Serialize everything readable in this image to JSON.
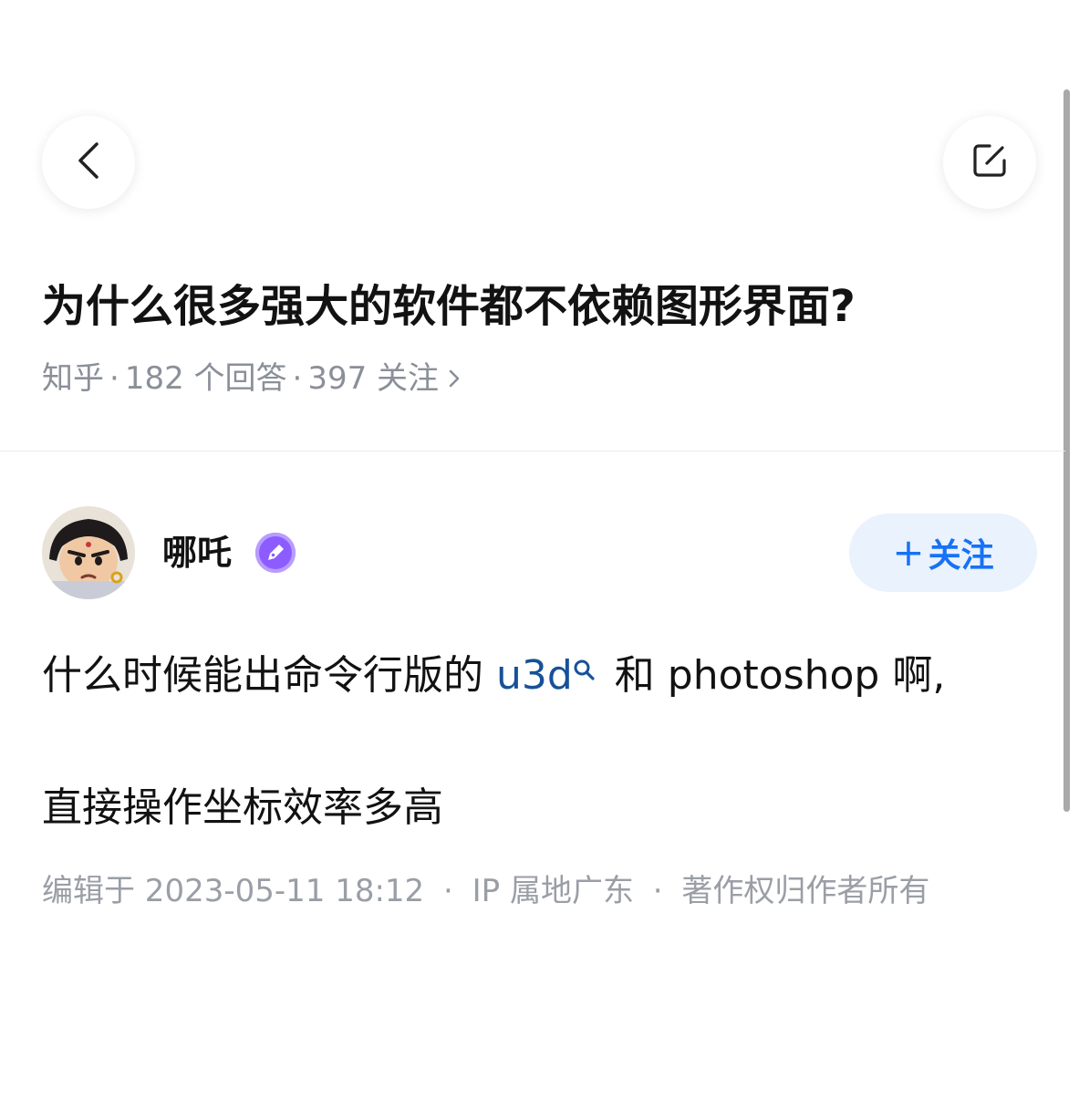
{
  "question": {
    "title": "为什么很多强大的软件都不依赖图形界面?",
    "source": "知乎",
    "answers": "182 个回答",
    "followers": "397 关注",
    "separator": "·"
  },
  "author": {
    "name": "哪吒",
    "follow_label": "关注",
    "follow_plus": "+"
  },
  "answer": {
    "line1_before": "什么时候能出命令行版的 ",
    "keyword": "u3d",
    "line1_after": " 和 photoshop 啊,",
    "line2": "直接操作坐标效率多高",
    "edited": "编辑于 2023-05-11 18:12",
    "ip": "IP 属地广东",
    "copyright": "著作权归作者所有",
    "separator": "·"
  },
  "colors": {
    "accent": "#1772f6",
    "link": "#175199",
    "muted": "#8a8f99",
    "badge": "#8c5cff"
  }
}
